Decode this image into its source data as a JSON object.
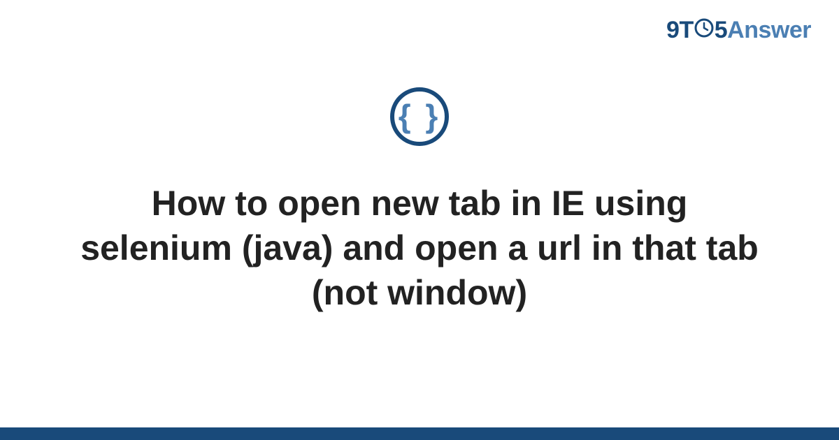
{
  "logo": {
    "part1": "9",
    "part2": "T",
    "part3": "5",
    "part4": "Answer"
  },
  "category": {
    "icon_name": "code-braces-icon",
    "glyph": "{ }"
  },
  "title": "How to open new tab in IE using selenium (java) and open a url in that tab (not window)",
  "colors": {
    "dark_blue": "#194a7a",
    "light_blue": "#4b7fb3",
    "text": "#222222"
  }
}
